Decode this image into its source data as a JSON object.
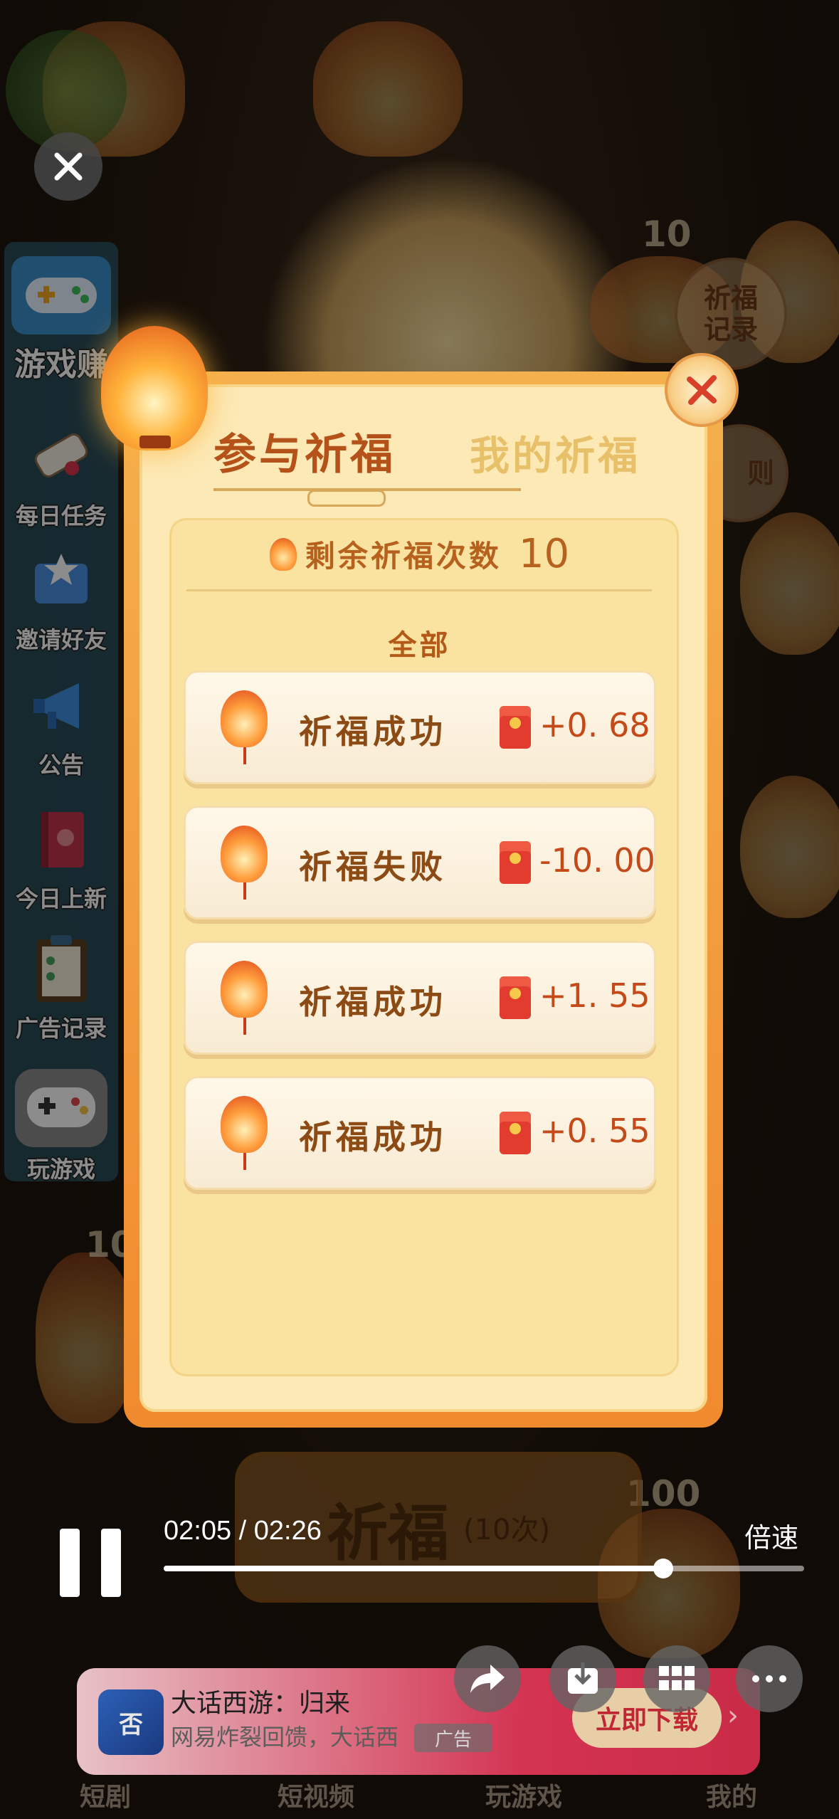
{
  "sidebar": {
    "items": [
      {
        "label": "游戏赚",
        "icon": "gamepad-icon"
      },
      {
        "label": "每日任务",
        "icon": "scroll-icon"
      },
      {
        "label": "邀请好友",
        "icon": "envelope-star-icon"
      },
      {
        "label": "公告",
        "icon": "megaphone-icon"
      },
      {
        "label": "今日上新",
        "icon": "book-icon"
      },
      {
        "label": "广告记录",
        "icon": "clipboard-icon"
      },
      {
        "label": "玩游戏",
        "icon": "controller-icon"
      }
    ]
  },
  "background": {
    "right_button_label_line1": "祈福",
    "right_button_label_line2": "记录",
    "rules_fragment": "则",
    "lantern_counts": [
      "10",
      "10",
      "100"
    ],
    "pray_button_label": "祈福",
    "pray_button_sub": "(10次)"
  },
  "modal": {
    "tab_active": "参与祈福",
    "tab_inactive": "我的祈福",
    "remaining_label": "剩余祈福次数",
    "remaining_count": "10",
    "filter_label": "全部",
    "records": [
      {
        "status": "祈福成功",
        "amount": "+0. 68"
      },
      {
        "status": "祈福失败",
        "amount": "-10. 00"
      },
      {
        "status": "祈福成功",
        "amount": "+1. 55"
      },
      {
        "status": "祈福成功",
        "amount": "+0. 55"
      }
    ]
  },
  "player": {
    "time": "02:05 / 02:26",
    "speed_label": "倍速",
    "progress": 0.78
  },
  "ad": {
    "icon_text": "否",
    "title": "大话西游：归来",
    "subtitle": "网易炸裂回馈，大话西",
    "tag": "广告",
    "cta": "立即下载"
  },
  "bottom_nav": {
    "items": [
      "短剧",
      "短视频",
      "玩游戏",
      "我的"
    ]
  }
}
